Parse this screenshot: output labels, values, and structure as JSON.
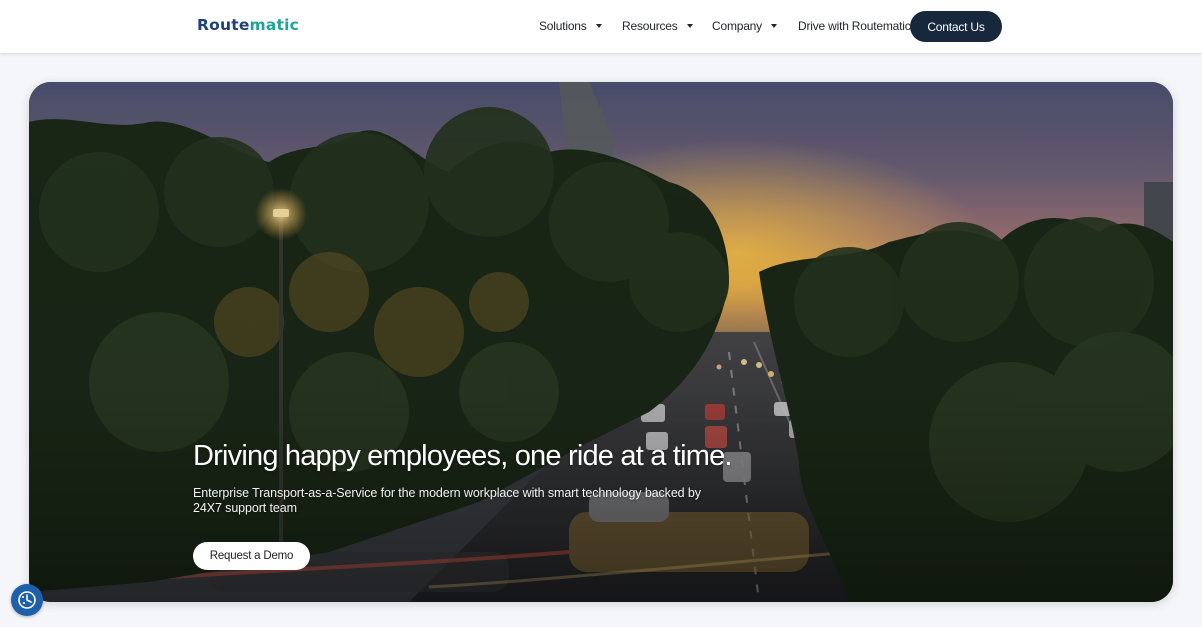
{
  "brand": {
    "logo_primary": "Route",
    "logo_accent": "matic"
  },
  "nav": {
    "items": [
      {
        "label": "Solutions",
        "has_dropdown": true
      },
      {
        "label": "Resources",
        "has_dropdown": true
      },
      {
        "label": "Company",
        "has_dropdown": true
      },
      {
        "label": "Drive with Routematic",
        "has_dropdown": false
      }
    ],
    "contact_label": "Contact Us"
  },
  "hero": {
    "title": "Driving happy employees, one ride at a time.",
    "subtitle": "Enterprise Transport-as-a-Service for the modern workplace with smart technology backed by 24X7 support team",
    "cta_label": "Request a Demo",
    "image": "dusk road with traffic lined by trees and street lamp"
  },
  "icons": {
    "consent": "cookie-consent-icon",
    "dropdown": "chevron-down-icon"
  },
  "colors": {
    "nav_text": "#23272e",
    "logo_primary": "#1e3f7a",
    "logo_accent": "#1fa39a",
    "contact_bg": "#17283c",
    "consent_bg": "#1d5fa8"
  }
}
